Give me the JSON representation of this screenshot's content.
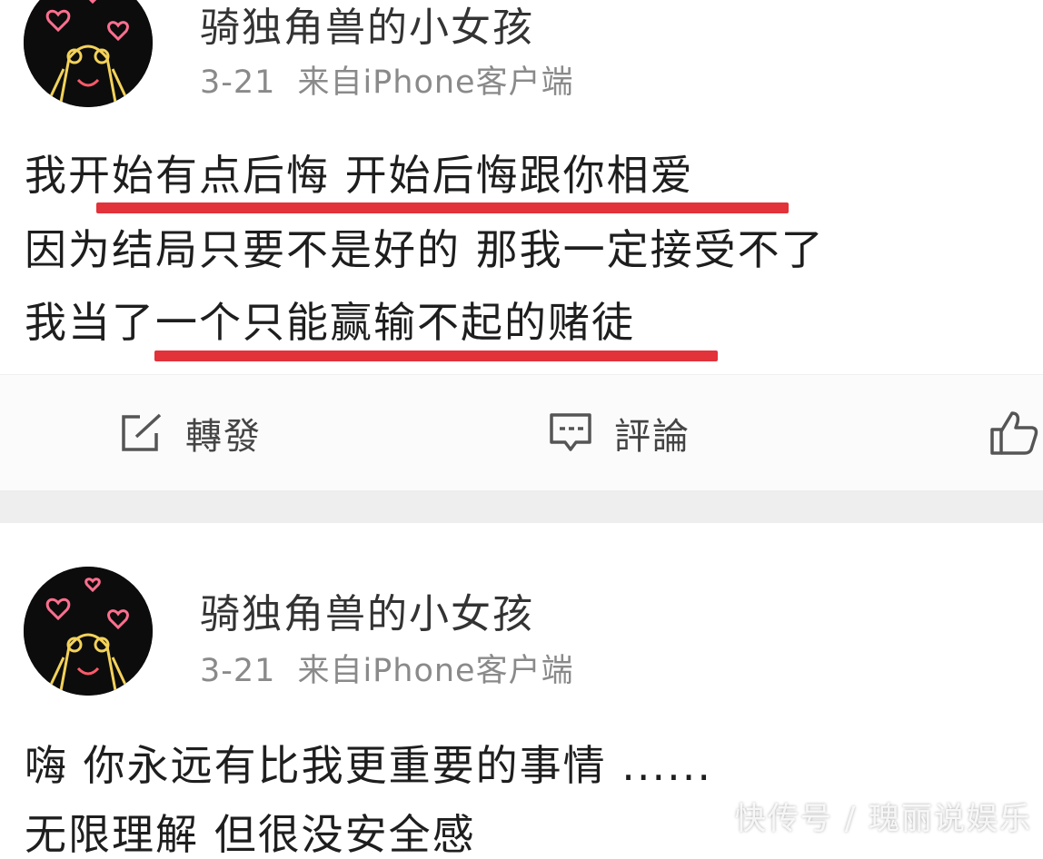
{
  "posts": [
    {
      "username": "骑独角兽的小女孩",
      "date": "3-21",
      "source": "来自iPhone客户端",
      "lines": [
        "我开始有点后悔 开始后悔跟你相爱",
        "因为结局只要不是好的 那我一定接受不了",
        "我当了一个只能赢输不起的赌徒"
      ],
      "actions": {
        "repost": "轉發",
        "comment": "評論"
      }
    },
    {
      "username": "骑独角兽的小女孩",
      "date": "3-21",
      "source": "来自iPhone客户端",
      "lines": [
        "嗨 你永远有比我更重要的事情 ......",
        "无限理解 但很没安全感"
      ]
    }
  ],
  "watermark": "快传号 / 瑰丽说娱乐",
  "colors": {
    "underline": "#e2323a",
    "separator": "#eeeeee",
    "meta_text": "#8a8a8a"
  },
  "icons": [
    "avatar-sailor-moon",
    "repost-icon",
    "comment-icon",
    "like-thumb-icon"
  ]
}
